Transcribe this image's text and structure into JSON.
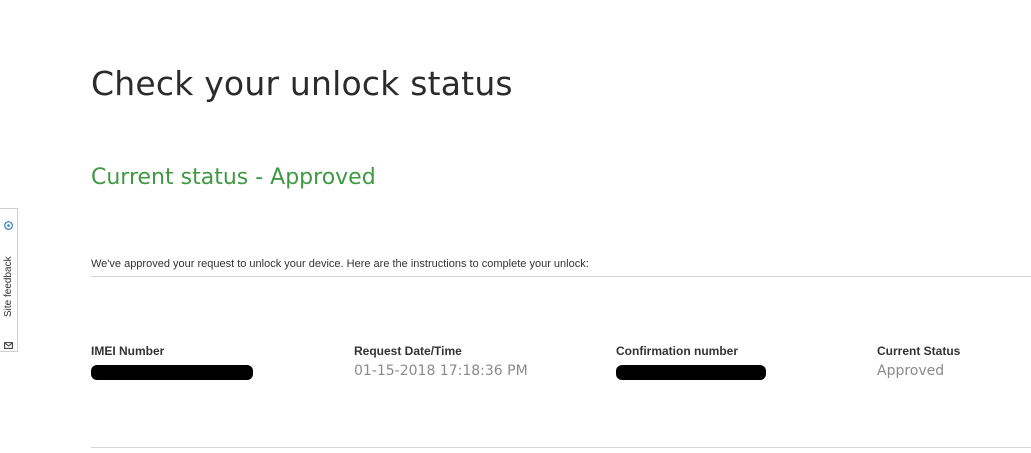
{
  "feedback": {
    "label": "Site feedback"
  },
  "page": {
    "title": "Check your unlock status",
    "status_heading": "Current status - Approved",
    "instructions": "We've approved your request to unlock your device. Here are the instructions to complete your unlock:"
  },
  "details": {
    "imei": {
      "label": "IMEI Number",
      "value_redacted": true
    },
    "request_date": {
      "label": "Request Date/Time",
      "value": "01-15-2018 17:18:36 PM"
    },
    "confirmation": {
      "label": "Confirmation number",
      "value_redacted": true
    },
    "current_status": {
      "label": "Current Status",
      "value": "Approved"
    }
  },
  "colors": {
    "status_green": "#3f9a43",
    "title_text": "#2b2b2b",
    "value_gray": "#8a8a8a",
    "redaction": "#000000",
    "feedback_icon_blue": "#2a7fc1"
  },
  "icons": {
    "feedback_top": "feedback-icon",
    "feedback_bottom": "mail-icon"
  }
}
